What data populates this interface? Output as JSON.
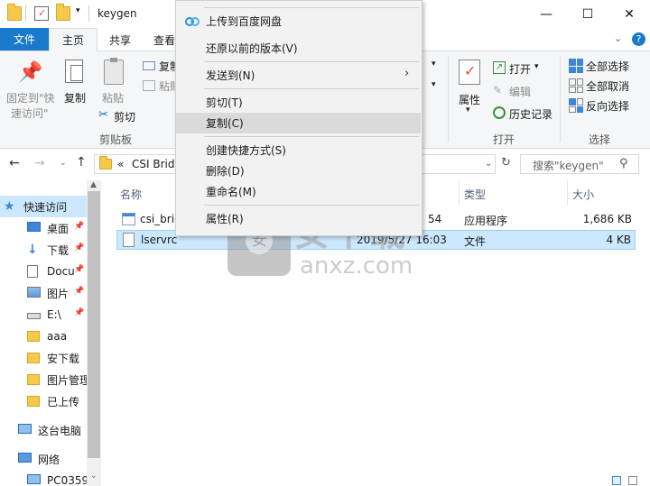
{
  "window": {
    "title": "keygen",
    "minimize": "—",
    "maximize": "☐",
    "close": "✕"
  },
  "tabs": {
    "file": "文件",
    "home": "主页",
    "share": "共享",
    "view": "查看"
  },
  "ribbon": {
    "pin": "固定到\"快",
    "pin2": "速访问\"",
    "copy": "复制",
    "paste": "粘贴",
    "copy_path": "复制",
    "paste_shortcut": "粘贴",
    "cut": "剪切",
    "clipboard_group": "剪贴板",
    "properties": "属性",
    "open": "打开",
    "edit": "编辑",
    "history": "历史记录",
    "open_group": "打开",
    "select_all": "全部选择",
    "select_none": "全部取消",
    "invert_selection": "反向选择",
    "select_group": "选择"
  },
  "address": {
    "prefix": "«",
    "path": "CSI Brid",
    "search_placeholder": "搜索\"keygen\""
  },
  "nav": {
    "items": [
      {
        "label": "快速访问",
        "icon": "star-icon",
        "pinned": false
      },
      {
        "label": "桌面",
        "icon": "desktop-icon",
        "pinned": true
      },
      {
        "label": "下载",
        "icon": "download-icon",
        "pinned": true
      },
      {
        "label": "Docu",
        "icon": "document-icon",
        "pinned": true
      },
      {
        "label": "图片",
        "icon": "picture-icon",
        "pinned": true
      },
      {
        "label": "E:\\",
        "icon": "drive-icon",
        "pinned": true
      },
      {
        "label": "aaa",
        "icon": "folder-icon",
        "pinned": false
      },
      {
        "label": "安下载",
        "icon": "folder-icon",
        "pinned": false
      },
      {
        "label": "图片管理",
        "icon": "folder-icon",
        "pinned": false
      },
      {
        "label": "已上传",
        "icon": "folder-icon",
        "pinned": false
      },
      {
        "label": "这台电脑",
        "icon": "computer-icon",
        "pinned": false
      },
      {
        "label": "网络",
        "icon": "network-icon",
        "pinned": false
      },
      {
        "label": "PC0359",
        "icon": "computer-icon",
        "pinned": false
      }
    ]
  },
  "columns": {
    "name": "名称",
    "type": "类型",
    "size": "大小"
  },
  "files": [
    {
      "name": "csi_brid",
      "date": "54",
      "type": "应用程序",
      "size": "1,686 KB",
      "selected": false
    },
    {
      "name": "lservrc",
      "date": "2019/5/27 16:03",
      "type": "文件",
      "size": "4 KB",
      "selected": true
    }
  ],
  "context_menu": {
    "items": [
      {
        "label": "上传到百度网盘",
        "icon": "baidu-cloud-icon"
      },
      {
        "label": "还原以前的版本(V)"
      },
      {
        "label": "发送到(N)",
        "submenu": true
      },
      {
        "label": "剪切(T)"
      },
      {
        "label": "复制(C)",
        "highlight": true
      },
      {
        "label": "创建快捷方式(S)"
      },
      {
        "label": "删除(D)"
      },
      {
        "label": "重命名(M)"
      },
      {
        "label": "属性(R)"
      }
    ]
  },
  "watermark": {
    "cn": "安下载",
    "en": "anxz.com"
  },
  "colors": {
    "accent": "#1979ca",
    "selection": "#cce8ff",
    "selection_border": "#99d1ff"
  }
}
